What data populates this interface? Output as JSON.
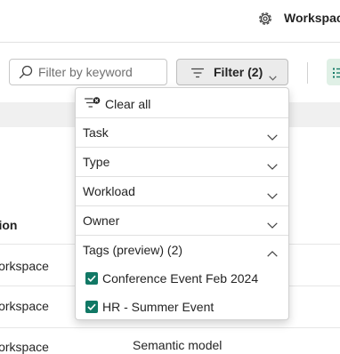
{
  "header": {
    "workspace_label": "Workspac",
    "settings_icon": "gear-icon"
  },
  "toolbar": {
    "search": {
      "placeholder": "Filter by keyword",
      "value": "",
      "icon": "search-icon"
    },
    "filter_button": {
      "label": "Filter (2)",
      "icon": "filter-lines-icon",
      "chevron": "chevron-down-icon"
    },
    "view_toggle_icon": "list-view-icon",
    "accent_color": "#117865"
  },
  "table": {
    "column_header": "ation",
    "rows": [
      {
        "location": "workspace",
        "type": ""
      },
      {
        "location": "workspace",
        "type": ""
      },
      {
        "location": "workspace",
        "type": "Semantic model"
      }
    ]
  },
  "filter_panel": {
    "clear_all_label": "Clear all",
    "clear_all_icon": "clear-filter-icon",
    "sections": [
      {
        "label": "Task",
        "expanded": false
      },
      {
        "label": "Type",
        "expanded": false
      },
      {
        "label": "Workload",
        "expanded": false
      },
      {
        "label": "Owner",
        "expanded": false
      },
      {
        "label": "Tags (preview) (2)",
        "expanded": true
      }
    ],
    "tags": [
      {
        "label": "Conference Event Feb 2024",
        "checked": true
      },
      {
        "label": "HR - Summer Event",
        "checked": true
      }
    ]
  }
}
